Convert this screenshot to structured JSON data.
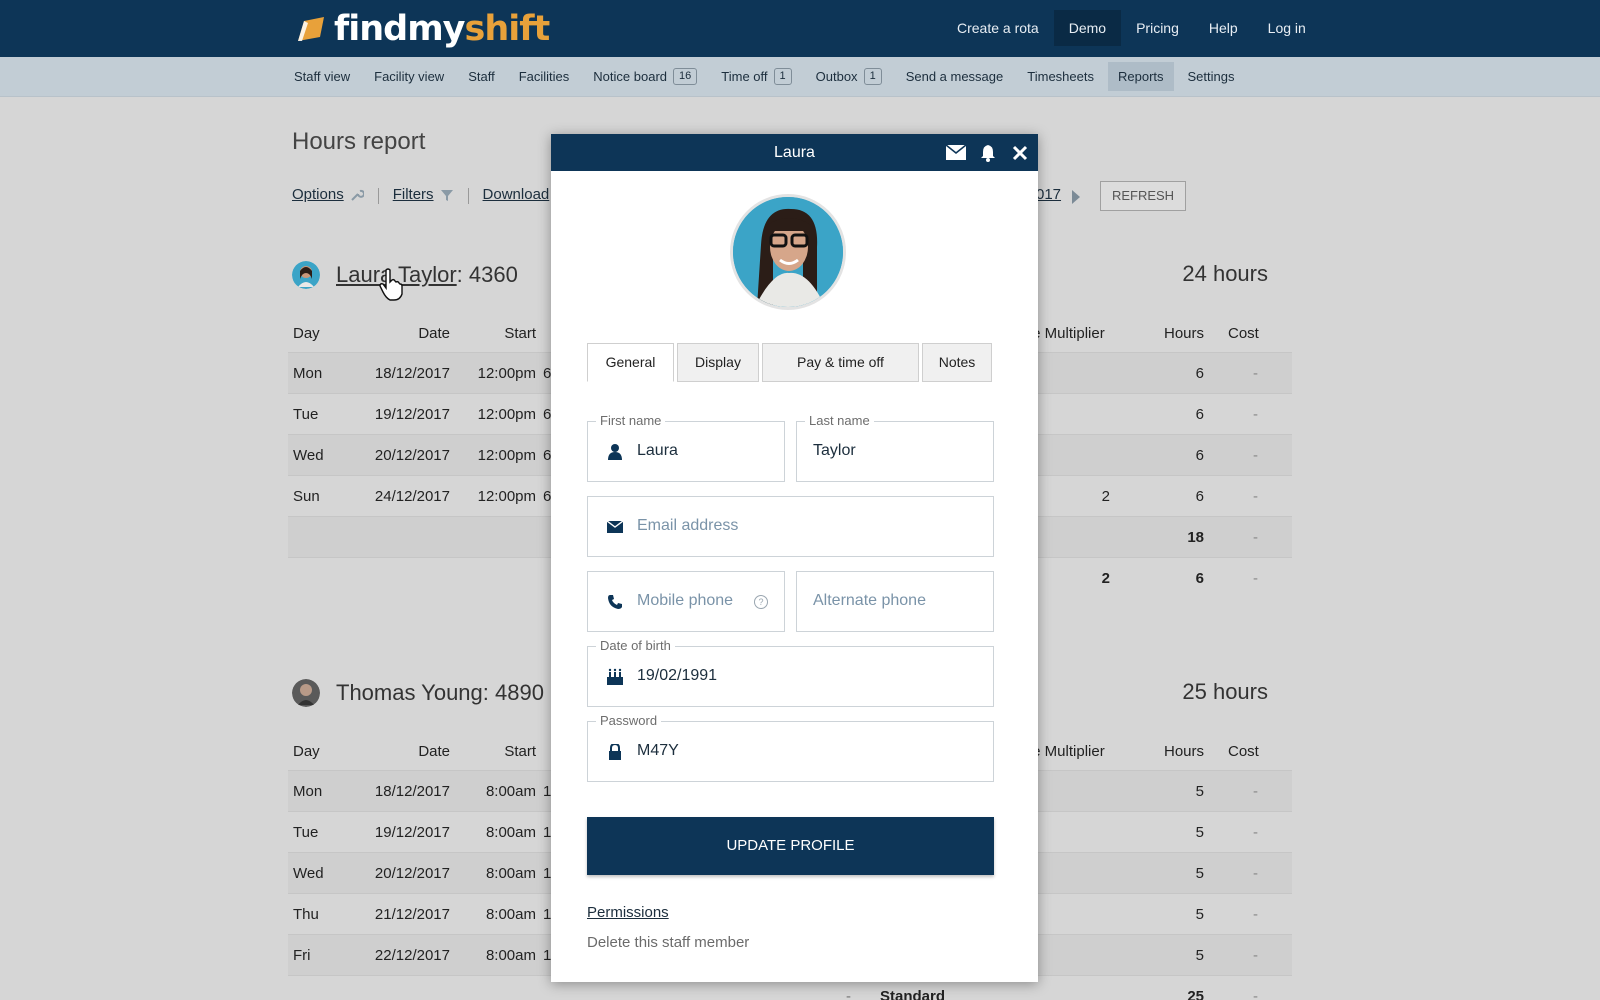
{
  "header": {
    "logo": {
      "find": "findmy",
      "shift": "shift"
    },
    "nav": [
      "Create a rota",
      "Demo",
      "Pricing",
      "Help",
      "Log in"
    ],
    "active_nav": "Demo"
  },
  "subnav": {
    "items": [
      {
        "label": "Staff view"
      },
      {
        "label": "Facility view"
      },
      {
        "label": "Staff"
      },
      {
        "label": "Facilities"
      },
      {
        "label": "Notice board",
        "badge": "16"
      },
      {
        "label": "Time off",
        "badge": "1"
      },
      {
        "label": "Outbox",
        "badge": "1"
      },
      {
        "label": "Send a message"
      },
      {
        "label": "Timesheets"
      },
      {
        "label": "Reports"
      },
      {
        "label": "Settings"
      }
    ],
    "active": "Reports"
  },
  "report": {
    "title": "Hours report",
    "toolbar": {
      "options": "Options",
      "filters": "Filters",
      "download": "Download"
    },
    "date_end": "017",
    "refresh": "REFRESH",
    "staff": [
      {
        "name": "Laura Taylor",
        "id": ": 4360",
        "total": "24 hours",
        "columns": {
          "day": "Day",
          "date": "Date",
          "start": "Start",
          "multiplier": "te Multiplier",
          "hours": "Hours",
          "cost": "Cost"
        },
        "rows": [
          {
            "day": "Mon",
            "date": "18/12/2017",
            "start": "12:00pm",
            "end": "6",
            "mult": "",
            "hours": "6",
            "cost": "-"
          },
          {
            "day": "Tue",
            "date": "19/12/2017",
            "start": "12:00pm",
            "end": "6",
            "mult": "",
            "hours": "6",
            "cost": "-"
          },
          {
            "day": "Wed",
            "date": "20/12/2017",
            "start": "12:00pm",
            "end": "6",
            "mult": "",
            "hours": "6",
            "cost": "-"
          },
          {
            "day": "Sun",
            "date": "24/12/2017",
            "start": "12:00pm",
            "end": "6",
            "mult": "2",
            "hours": "6",
            "cost": "-"
          }
        ],
        "subtotals": [
          {
            "mult": "",
            "hours": "18",
            "cost": "-"
          },
          {
            "mult": "2",
            "hours": "6",
            "cost": "-"
          }
        ]
      },
      {
        "name": "Thomas Young",
        "id": " : 4890",
        "total": "25 hours",
        "columns": {
          "day": "Day",
          "date": "Date",
          "start": "Start",
          "multiplier": "te Multiplier",
          "hours": "Hours",
          "cost": "Cost"
        },
        "rows": [
          {
            "day": "Mon",
            "date": "18/12/2017",
            "start": "8:00am",
            "end": "1",
            "hours": "5",
            "cost": "-"
          },
          {
            "day": "Tue",
            "date": "19/12/2017",
            "start": "8:00am",
            "end": "1",
            "hours": "5",
            "cost": "-"
          },
          {
            "day": "Wed",
            "date": "20/12/2017",
            "start": "8:00am",
            "end": "1",
            "hours": "5",
            "cost": "-"
          },
          {
            "day": "Thu",
            "date": "21/12/2017",
            "start": "8:00am",
            "end": "1",
            "hours": "5",
            "cost": "-"
          },
          {
            "day": "Fri",
            "date": "22/12/2017",
            "start": "8:00am",
            "end": "1",
            "hours": "5",
            "cost": "-"
          }
        ],
        "footer": {
          "dash": "-",
          "label": "Standard",
          "hours": "25",
          "cost": "-"
        }
      }
    ]
  },
  "modal": {
    "title": "Laura",
    "tabs": [
      "General",
      "Display",
      "Pay & time off",
      "Notes"
    ],
    "active_tab": "General",
    "fields": {
      "first_name": {
        "label": "First name",
        "value": "Laura"
      },
      "last_name": {
        "label": "Last name",
        "value": "Taylor"
      },
      "email": {
        "placeholder": "Email address"
      },
      "mobile": {
        "placeholder": "Mobile phone",
        "help": "?"
      },
      "alt_phone": {
        "placeholder": "Alternate phone"
      },
      "dob": {
        "label": "Date of birth",
        "value": "19/02/1991"
      },
      "password": {
        "label": "Password",
        "value": "M47Y"
      }
    },
    "update_button": "UPDATE PROFILE",
    "permissions": "Permissions",
    "delete": "Delete this staff member"
  },
  "colors": {
    "brand_navy": "#0d3557",
    "logo_orange": "#e8a13a",
    "subnav": "#c2cdd5"
  }
}
